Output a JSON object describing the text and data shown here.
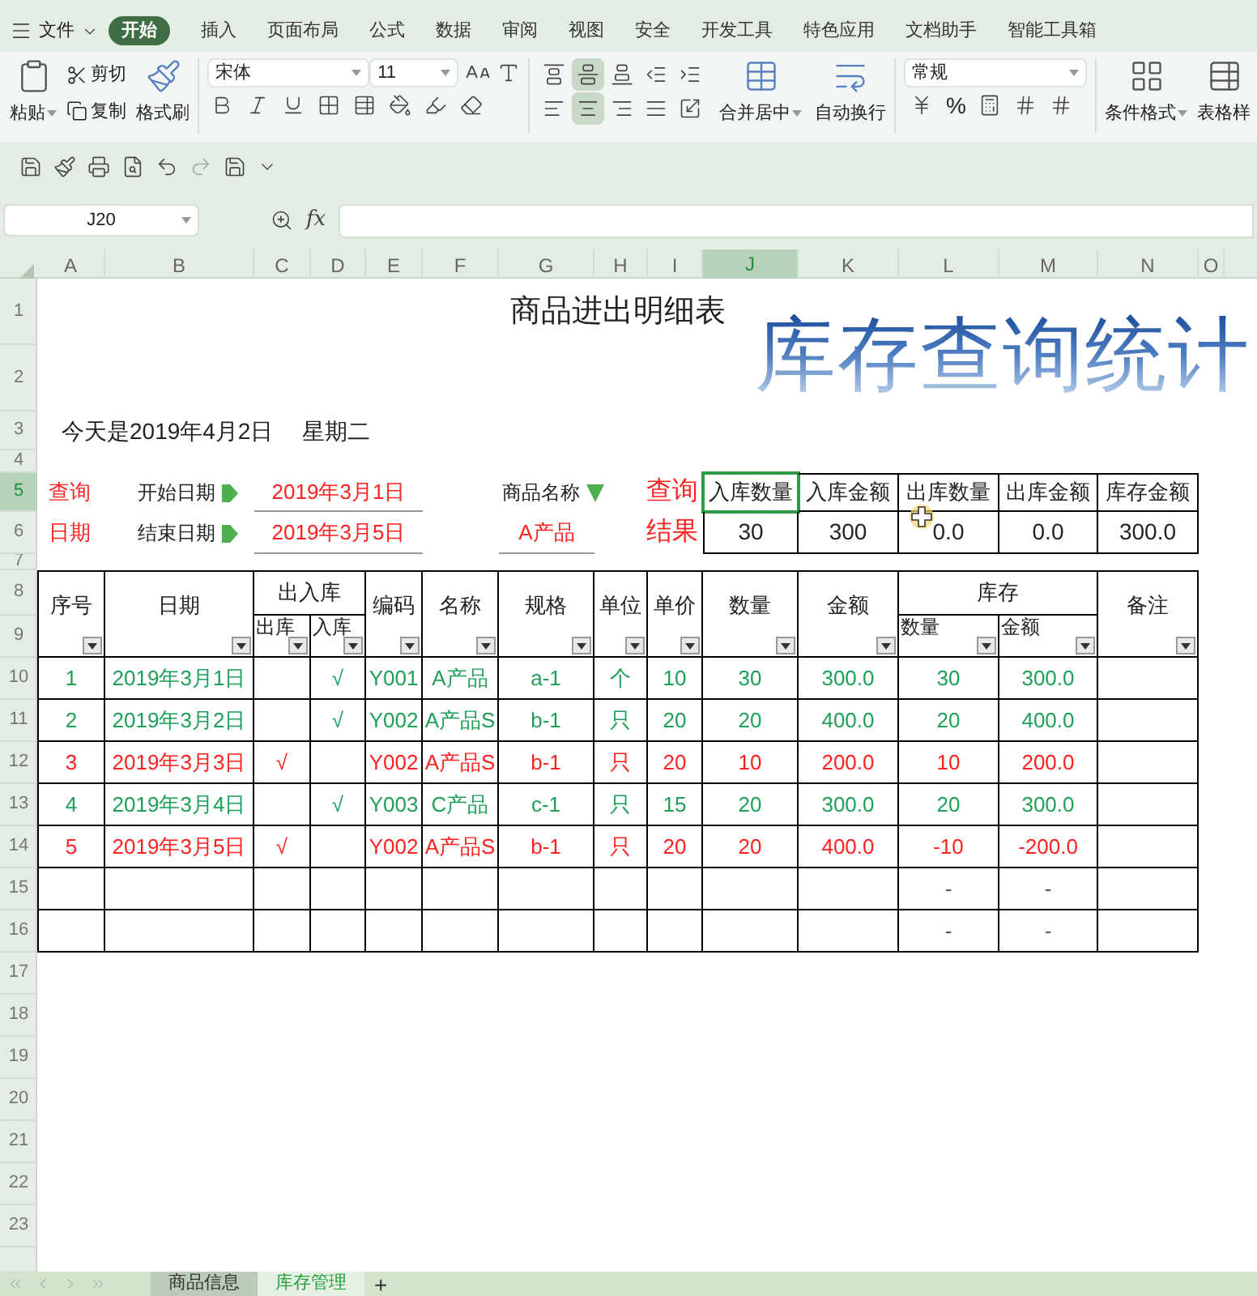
{
  "menu": {
    "file": "文件",
    "tabs": [
      {
        "label": "开始",
        "selected": true
      },
      {
        "label": "插入",
        "selected": false
      },
      {
        "label": "页面布局",
        "selected": false
      },
      {
        "label": "公式",
        "selected": false
      },
      {
        "label": "数据",
        "selected": false
      },
      {
        "label": "审阅",
        "selected": false
      },
      {
        "label": "视图",
        "selected": false
      },
      {
        "label": "安全",
        "selected": false
      },
      {
        "label": "开发工具",
        "selected": false
      },
      {
        "label": "特色应用",
        "selected": false
      },
      {
        "label": "文档助手",
        "selected": false
      },
      {
        "label": "智能工具箱",
        "selected": false
      }
    ]
  },
  "ribbon": {
    "paste": "粘贴",
    "cut": "剪切",
    "copy": "复制",
    "format_painter": "格式刷",
    "font": "宋体",
    "font_size": "11",
    "merge_center": "合并居中",
    "wrap_text": "自动换行",
    "number_format": "常规",
    "percent": "%",
    "conditional_format": "条件格式",
    "table_style": "表格样",
    "vertical_align": [
      {
        "selected": false
      },
      {
        "selected": true
      },
      {
        "selected": false
      }
    ],
    "horizontal_align": [
      {
        "selected": false
      },
      {
        "selected": true
      },
      {
        "selected": false
      }
    ]
  },
  "formula_bar": {
    "name_box": "J20",
    "fx": "fx"
  },
  "columns": [
    {
      "label": "A",
      "selected": false
    },
    {
      "label": "B",
      "selected": false
    },
    {
      "label": "C",
      "selected": false
    },
    {
      "label": "D",
      "selected": false
    },
    {
      "label": "E",
      "selected": false
    },
    {
      "label": "F",
      "selected": false
    },
    {
      "label": "G",
      "selected": false
    },
    {
      "label": "H",
      "selected": false
    },
    {
      "label": "I",
      "selected": false
    },
    {
      "label": "J",
      "selected": true
    },
    {
      "label": "K",
      "selected": false
    },
    {
      "label": "L",
      "selected": false
    },
    {
      "label": "M",
      "selected": false
    },
    {
      "label": "N",
      "selected": false
    },
    {
      "label": "O",
      "selected": false
    }
  ],
  "row_numbers": [
    {
      "label": "1",
      "selected": false
    },
    {
      "label": "2",
      "selected": false
    },
    {
      "label": "3",
      "selected": false
    },
    {
      "label": "4",
      "selected": false
    },
    {
      "label": "5",
      "selected": true
    },
    {
      "label": "6",
      "selected": false
    },
    {
      "label": "7",
      "selected": false
    },
    {
      "label": "8",
      "selected": false
    },
    {
      "label": "9",
      "selected": false
    },
    {
      "label": "10",
      "selected": false
    },
    {
      "label": "11",
      "selected": false
    },
    {
      "label": "12",
      "selected": false
    },
    {
      "label": "13",
      "selected": false
    },
    {
      "label": "14",
      "selected": false
    },
    {
      "label": "15",
      "selected": false
    },
    {
      "label": "16",
      "selected": false
    },
    {
      "label": "17",
      "selected": false
    },
    {
      "label": "18",
      "selected": false
    },
    {
      "label": "19",
      "selected": false
    },
    {
      "label": "20",
      "selected": false
    },
    {
      "label": "21",
      "selected": false
    },
    {
      "label": "22",
      "selected": false
    },
    {
      "label": "23",
      "selected": false
    }
  ],
  "sheet": {
    "title": "商品进出明细表",
    "wordart": "库存查询统计",
    "today": "今天是2019年4月2日",
    "weekday": "星期二",
    "query": {
      "label_top": "查询",
      "label_bottom": "日期",
      "start_label": "开始日期",
      "start_value": "2019年3月1日",
      "end_label": "结束日期",
      "end_value": "2019年3月5日",
      "product_label": "商品名称",
      "product_value": "A产品",
      "result_top": "查询",
      "result_bottom": "结果"
    },
    "summary": {
      "headers": [
        {
          "label": "入库数量",
          "selected": true
        },
        {
          "label": "入库金额",
          "selected": false
        },
        {
          "label": "出库数量",
          "selected": false
        },
        {
          "label": "出库金额",
          "selected": false
        },
        {
          "label": "库存金额",
          "selected": false
        }
      ],
      "values": [
        "30",
        "300",
        "0.0",
        "0.0",
        "300.0"
      ]
    },
    "table": {
      "columns": [
        {
          "kind": "single",
          "label": "序号"
        },
        {
          "kind": "single",
          "label": "日期"
        },
        {
          "kind": "group",
          "label": "出入库",
          "children": [
            {
              "label": "出库"
            },
            {
              "label": "入库"
            }
          ]
        },
        {
          "kind": "single",
          "label": "编码"
        },
        {
          "kind": "single",
          "label": "名称"
        },
        {
          "kind": "single",
          "label": "规格"
        },
        {
          "kind": "single",
          "label": "单位"
        },
        {
          "kind": "single",
          "label": "单价"
        },
        {
          "kind": "single",
          "label": "数量"
        },
        {
          "kind": "single",
          "label": "金额"
        },
        {
          "kind": "group",
          "label": "库存",
          "children": [
            {
              "label": "数量"
            },
            {
              "label": "金额"
            }
          ]
        },
        {
          "kind": "single",
          "label": "备注"
        }
      ],
      "rows": [
        {
          "color": "#1fa05a",
          "seq": "1",
          "date": "2019年3月1日",
          "in_mark": "√",
          "code": "Y001",
          "name": "A产品",
          "spec": "a-1",
          "unit": "个",
          "price": "10",
          "qty": "30",
          "amount": "300.0",
          "stock_qty": "30",
          "stock_amount": "300.0"
        },
        {
          "color": "#1fa05a",
          "seq": "2",
          "date": "2019年3月2日",
          "in_mark": "√",
          "code": "Y002",
          "name": "A产品S",
          "spec": "b-1",
          "unit": "只",
          "price": "20",
          "qty": "20",
          "amount": "400.0",
          "stock_qty": "20",
          "stock_amount": "400.0"
        },
        {
          "color": "#ff2020",
          "seq": "3",
          "date": "2019年3月3日",
          "out_mark": "√",
          "code": "Y002",
          "name": "A产品S",
          "spec": "b-1",
          "unit": "只",
          "price": "20",
          "qty": "10",
          "amount": "200.0",
          "stock_qty": "10",
          "stock_amount": "200.0"
        },
        {
          "color": "#1fa05a",
          "seq": "4",
          "date": "2019年3月4日",
          "in_mark": "√",
          "code": "Y003",
          "name": "C产品",
          "spec": "c-1",
          "unit": "只",
          "price": "15",
          "qty": "20",
          "amount": "300.0",
          "stock_qty": "20",
          "stock_amount": "300.0"
        },
        {
          "color": "#ff2020",
          "seq": "5",
          "date": "2019年3月5日",
          "out_mark": "√",
          "code": "Y002",
          "name": "A产品S",
          "spec": "b-1",
          "unit": "只",
          "price": "20",
          "qty": "20",
          "amount": "400.0",
          "stock_qty": "-10",
          "stock_amount": "-200.0"
        },
        {
          "color": "#555555",
          "stock_qty": "-",
          "stock_amount": "-"
        },
        {
          "color": "#555555",
          "stock_qty": "-",
          "stock_amount": "-"
        }
      ]
    }
  },
  "sheet_tabs": [
    {
      "label": "商品信息",
      "selected": false
    },
    {
      "label": "库存管理",
      "selected": true
    }
  ],
  "add_sheet": "+"
}
